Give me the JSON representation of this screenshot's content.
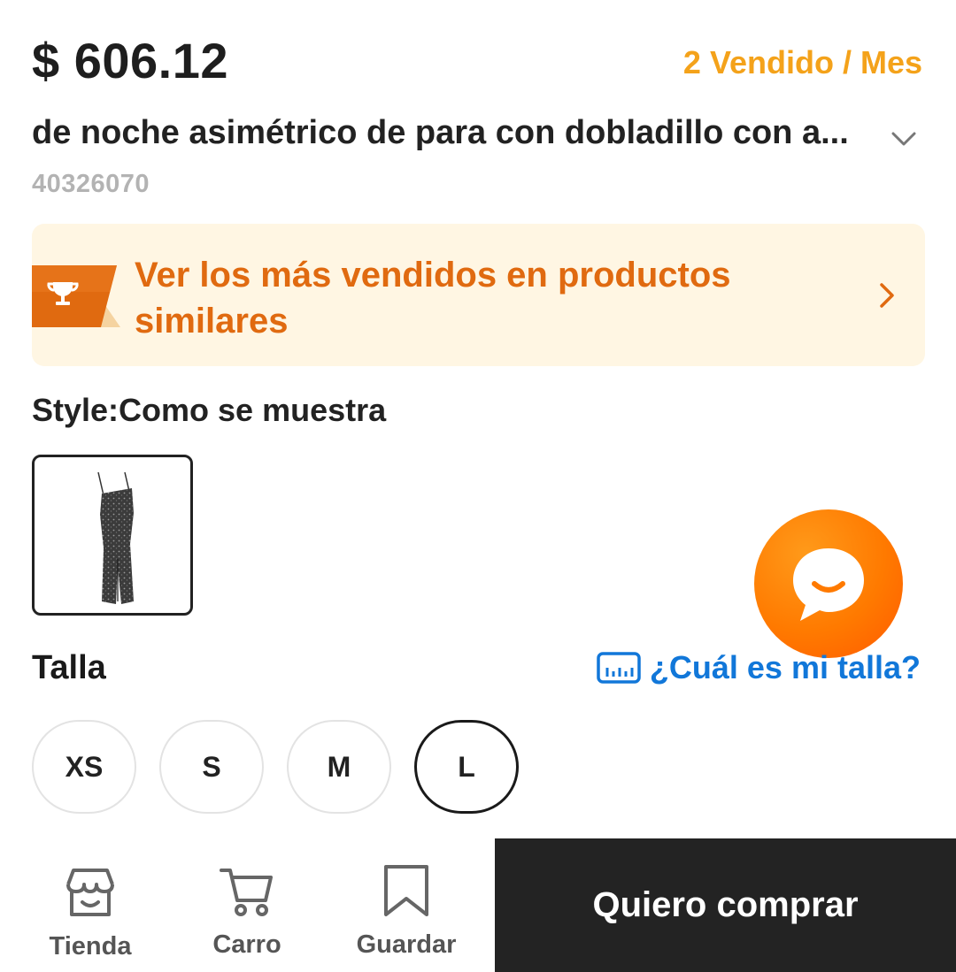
{
  "product": {
    "price": "$ 606.12",
    "sold": "2 Vendido / Mes",
    "title": "de noche asimétrico de para con dobladillo con a...",
    "code": "40326070"
  },
  "banner": {
    "text": "Ver los más vendidos en productos similares",
    "icon": "trophy-icon",
    "background": "#fff6e3",
    "accent": "#e06a10"
  },
  "style": {
    "label": "Style:Como se muestra"
  },
  "size": {
    "label": "Talla",
    "guide": "¿Cuál es mi talla?",
    "options": [
      "XS",
      "S",
      "M",
      "L"
    ],
    "selected": "L"
  },
  "bottom_nav": {
    "store": "Tienda",
    "cart": "Carro",
    "save": "Guardar",
    "buy": "Quiero comprar"
  },
  "colors": {
    "sold": "#f4a21a",
    "link": "#1177d9",
    "chat": "#ff7a00",
    "buy_bg": "#232323"
  }
}
